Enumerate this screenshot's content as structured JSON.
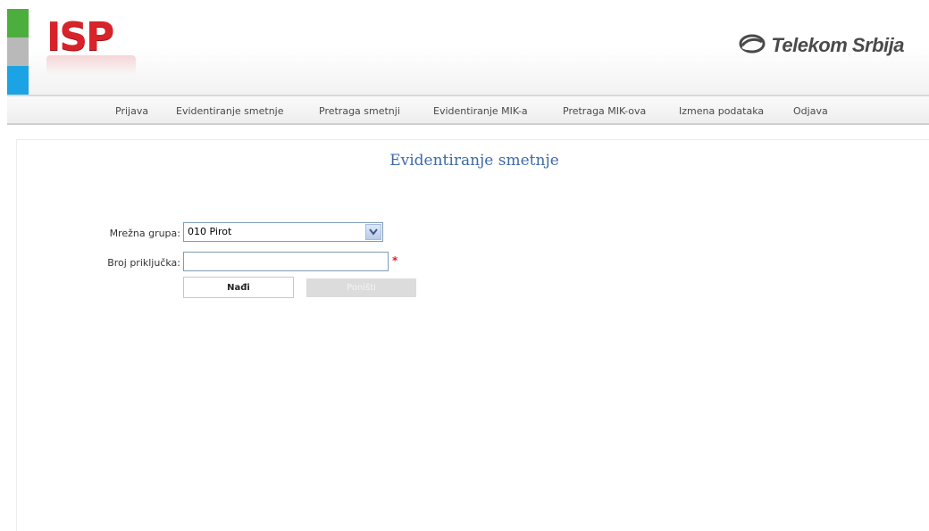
{
  "header": {
    "logo_text": "ISP",
    "brand_text": "Telekom Srbija",
    "colors": {
      "green": "#4caf3d",
      "silver": "#b9b9b9",
      "blue": "#1ba3e3",
      "logo_red": "#d8232a"
    }
  },
  "nav": {
    "items": [
      "Prijava",
      "Evidentiranje smetnje",
      "Pretraga smetnji",
      "Evidentiranje MIK-a",
      "Pretraga MIK-ova",
      "Izmena podataka",
      "Odjava"
    ]
  },
  "page": {
    "title": "Evidentiranje smetnje",
    "title_color": "#3d6aa6"
  },
  "form": {
    "network_group_label": "Mrežna grupa:",
    "network_group_value": "010 Pirot",
    "connection_number_label": "Broj priključka:",
    "connection_number_value": "",
    "required_marker": "*",
    "find_button": "Nađi",
    "reset_button": "Poništi"
  }
}
